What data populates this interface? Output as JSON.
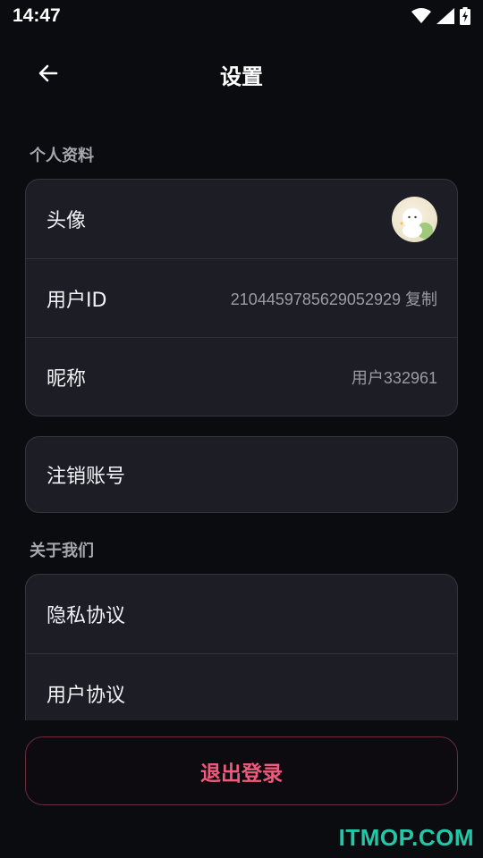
{
  "status_bar": {
    "time": "14:47",
    "icons": [
      "wifi-icon",
      "signal-icon",
      "battery-charging-icon"
    ]
  },
  "header": {
    "back_icon": "arrow-left-icon",
    "title": "设置"
  },
  "profile_section": {
    "title": "个人资料",
    "rows": [
      {
        "label": "头像",
        "value": ""
      },
      {
        "label": "用户ID",
        "value": "2104459785629052929 复制"
      },
      {
        "label": "昵称",
        "value": "用户332961"
      }
    ]
  },
  "account_section": {
    "rows": [
      {
        "label": "注销账号"
      }
    ]
  },
  "about_section": {
    "title": "关于我们",
    "rows": [
      {
        "label": "隐私协议"
      },
      {
        "label": "用户协议"
      }
    ]
  },
  "logout": {
    "label": "退出登录"
  },
  "watermark": {
    "text": "ITMOP.COM"
  },
  "colors": {
    "background": "#0b0c0f",
    "card": "#1d1e25",
    "accent": "#f0597c",
    "watermark": "#23c6a6"
  }
}
